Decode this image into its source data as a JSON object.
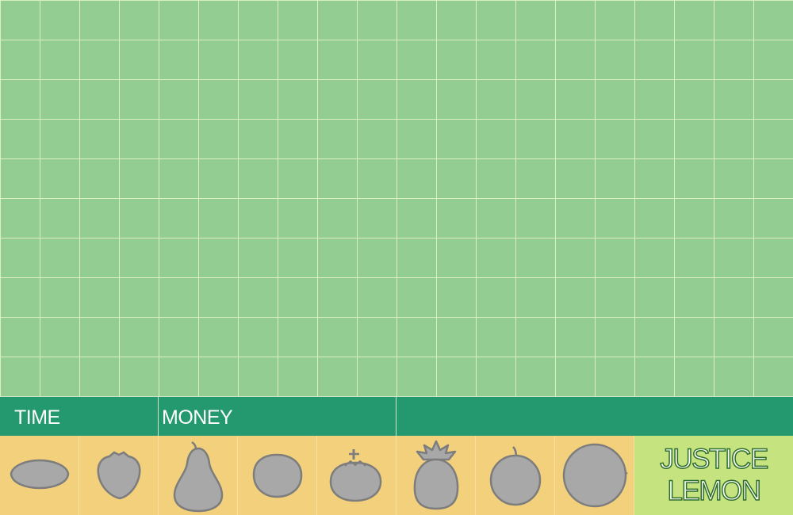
{
  "hud": {
    "time_label": "TIME",
    "money_label": "MONEY"
  },
  "tray": {
    "fruits": [
      {
        "name": "lemon-icon"
      },
      {
        "name": "strawberry-icon"
      },
      {
        "name": "pear-icon"
      },
      {
        "name": "lime-icon"
      },
      {
        "name": "tomato-icon"
      },
      {
        "name": "pineapple-icon"
      },
      {
        "name": "orange-icon"
      },
      {
        "name": "melon-icon"
      }
    ]
  },
  "selected_fruit": {
    "line1": "JUSTICE",
    "line2": "LEMON"
  },
  "colors": {
    "field": "#94cd91",
    "grid_line": "#e8f5c8",
    "status_bar": "#24986e",
    "tray": "#f2d07c",
    "selected_panel": "#c5e47f",
    "fruit_fill": "#a8a8a8",
    "fruit_outline": "#7d7d7d"
  }
}
